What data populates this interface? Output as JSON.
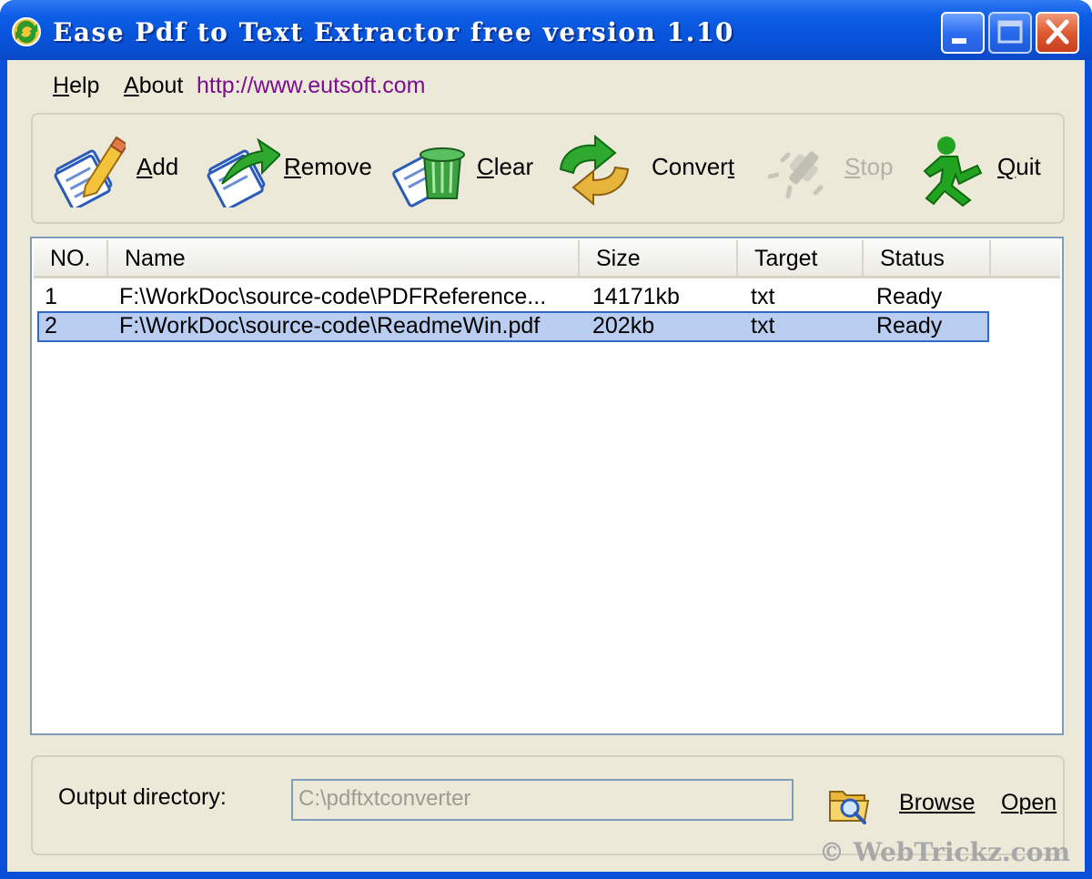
{
  "window": {
    "title": "Ease Pdf to Text Extractor free version 1.10"
  },
  "menu": {
    "help_pre": "",
    "help_u": "H",
    "help_rest": "elp",
    "about_u": "A",
    "about_rest": "bout",
    "link": "http://www.eutsoft.com"
  },
  "toolbar": {
    "add": {
      "u": "A",
      "rest": "dd"
    },
    "remove": {
      "u": "R",
      "rest": "emove"
    },
    "clear": {
      "u": "C",
      "rest": "lear"
    },
    "convert": {
      "pre": "Conver",
      "u": "t",
      "rest": ""
    },
    "stop": {
      "u": "S",
      "rest": "top"
    },
    "quit": {
      "u": "Q",
      "rest": "uit"
    }
  },
  "list": {
    "columns": [
      "NO.",
      "Name",
      "Size",
      "Target",
      "Status"
    ],
    "rows": [
      {
        "no": "1",
        "name": "F:\\WorkDoc\\source-code\\PDFReference...",
        "size": "14171kb",
        "target": "txt",
        "status": "Ready"
      },
      {
        "no": "2",
        "name": "F:\\WorkDoc\\source-code\\ReadmeWin.pdf",
        "size": "202kb",
        "target": "txt",
        "status": "Ready"
      }
    ]
  },
  "output": {
    "label": "Output directory:",
    "value": "C:\\pdftxtconverter",
    "browse_u": "B",
    "browse_rest": "rowse",
    "open_u": "O",
    "open_rest": "pen"
  },
  "watermark": "© WebTrickz.com",
  "colors": {
    "titlebar": "#0a50d8",
    "client": "#ece9d8",
    "selection": "#b9cdf0",
    "link": "#7a0f8c"
  }
}
